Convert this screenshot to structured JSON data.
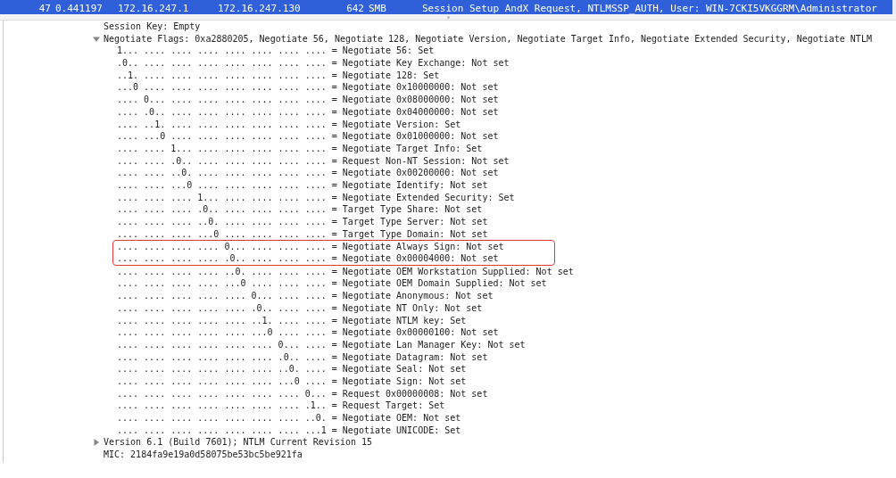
{
  "packet_list": {
    "rows": [
      {
        "selected": true,
        "no": "47",
        "time": "0.441197",
        "source": "172.16.247.1",
        "destination": "172.16.247.130",
        "length": "642",
        "protocol": "SMB",
        "info": "Session Setup AndX Request, NTLMSSP_AUTH, User: WIN-7CKI5VKGGRM\\Administrator"
      }
    ]
  },
  "details": {
    "items": [
      {
        "kind": "field",
        "text": "Session Key: Empty"
      },
      {
        "kind": "subtree",
        "expanded": true,
        "text": "Negotiate Flags: 0xa2880205, Negotiate 56, Negotiate 128, Negotiate Version, Negotiate Target Info, Negotiate Extended Security, Negotiate NTLM",
        "children": [
          {
            "bits": "1... .... .... .... .... .... .... ....",
            "label": "= Negotiate 56: Set",
            "outlined": false
          },
          {
            "bits": ".0.. .... .... .... .... .... .... ....",
            "label": "= Negotiate Key Exchange: Not set",
            "outlined": false
          },
          {
            "bits": "..1. .... .... .... .... .... .... ....",
            "label": "= Negotiate 128: Set",
            "outlined": false
          },
          {
            "bits": "...0 .... .... .... .... .... .... ....",
            "label": "= Negotiate 0x10000000: Not set",
            "outlined": false
          },
          {
            "bits": ".... 0... .... .... .... .... .... ....",
            "label": "= Negotiate 0x08000000: Not set",
            "outlined": false
          },
          {
            "bits": ".... .0.. .... .... .... .... .... ....",
            "label": "= Negotiate 0x04000000: Not set",
            "outlined": false
          },
          {
            "bits": ".... ..1. .... .... .... .... .... ....",
            "label": "= Negotiate Version: Set",
            "outlined": false
          },
          {
            "bits": ".... ...0 .... .... .... .... .... ....",
            "label": "= Negotiate 0x01000000: Not set",
            "outlined": false
          },
          {
            "bits": ".... .... 1... .... .... .... .... ....",
            "label": "= Negotiate Target Info: Set",
            "outlined": false
          },
          {
            "bits": ".... .... .0.. .... .... .... .... ....",
            "label": "= Request Non-NT Session: Not set",
            "outlined": false
          },
          {
            "bits": ".... .... ..0. .... .... .... .... ....",
            "label": "= Negotiate 0x00200000: Not set",
            "outlined": false
          },
          {
            "bits": ".... .... ...0 .... .... .... .... ....",
            "label": "= Negotiate Identify: Not set",
            "outlined": false
          },
          {
            "bits": ".... .... .... 1... .... .... .... ....",
            "label": "= Negotiate Extended Security: Set",
            "outlined": false
          },
          {
            "bits": ".... .... .... .0.. .... .... .... ....",
            "label": "= Target Type Share: Not set",
            "outlined": false
          },
          {
            "bits": ".... .... .... ..0. .... .... .... ....",
            "label": "= Target Type Server: Not set",
            "outlined": false
          },
          {
            "bits": ".... .... .... ...0 .... .... .... ....",
            "label": "= Target Type Domain: Not set",
            "outlined": false
          },
          {
            "bits": ".... .... .... .... 0... .... .... ....",
            "label": "= Negotiate Always Sign: Not set",
            "outlined": true
          },
          {
            "bits": ".... .... .... .... .0.. .... .... ....",
            "label": "= Negotiate 0x00004000: Not set",
            "outlined": true
          },
          {
            "bits": ".... .... .... .... ..0. .... .... ....",
            "label": "= Negotiate OEM Workstation Supplied: Not set",
            "outlined": false
          },
          {
            "bits": ".... .... .... .... ...0 .... .... ....",
            "label": "= Negotiate OEM Domain Supplied: Not set",
            "outlined": false
          },
          {
            "bits": ".... .... .... .... .... 0... .... ....",
            "label": "= Negotiate Anonymous: Not set",
            "outlined": false
          },
          {
            "bits": ".... .... .... .... .... .0.. .... ....",
            "label": "= Negotiate NT Only: Not set",
            "outlined": false
          },
          {
            "bits": ".... .... .... .... .... ..1. .... ....",
            "label": "= Negotiate NTLM key: Set",
            "outlined": false
          },
          {
            "bits": ".... .... .... .... .... ...0 .... ....",
            "label": "= Negotiate 0x00000100: Not set",
            "outlined": false
          },
          {
            "bits": ".... .... .... .... .... .... 0... ....",
            "label": "= Negotiate Lan Manager Key: Not set",
            "outlined": false
          },
          {
            "bits": ".... .... .... .... .... .... .0.. ....",
            "label": "= Negotiate Datagram: Not set",
            "outlined": false
          },
          {
            "bits": ".... .... .... .... .... .... ..0. ....",
            "label": "= Negotiate Seal: Not set",
            "outlined": false
          },
          {
            "bits": ".... .... .... .... .... .... ...0 ....",
            "label": "= Negotiate Sign: Not set",
            "outlined": false
          },
          {
            "bits": ".... .... .... .... .... .... .... 0...",
            "label": "= Request 0x00000008: Not set",
            "outlined": false
          },
          {
            "bits": ".... .... .... .... .... .... .... .1..",
            "label": "= Request Target: Set",
            "outlined": false
          },
          {
            "bits": ".... .... .... .... .... .... .... ..0.",
            "label": "= Negotiate OEM: Not set",
            "outlined": false
          },
          {
            "bits": ".... .... .... .... .... .... .... ...1",
            "label": "= Negotiate UNICODE: Set",
            "outlined": false
          }
        ]
      },
      {
        "kind": "subtree",
        "expanded": false,
        "text": "Version 6.1 (Build 7601); NTLM Current Revision 15"
      },
      {
        "kind": "field",
        "text": "MIC: 2184fa9e19a0d58075be53bc5be921fa"
      }
    ]
  }
}
